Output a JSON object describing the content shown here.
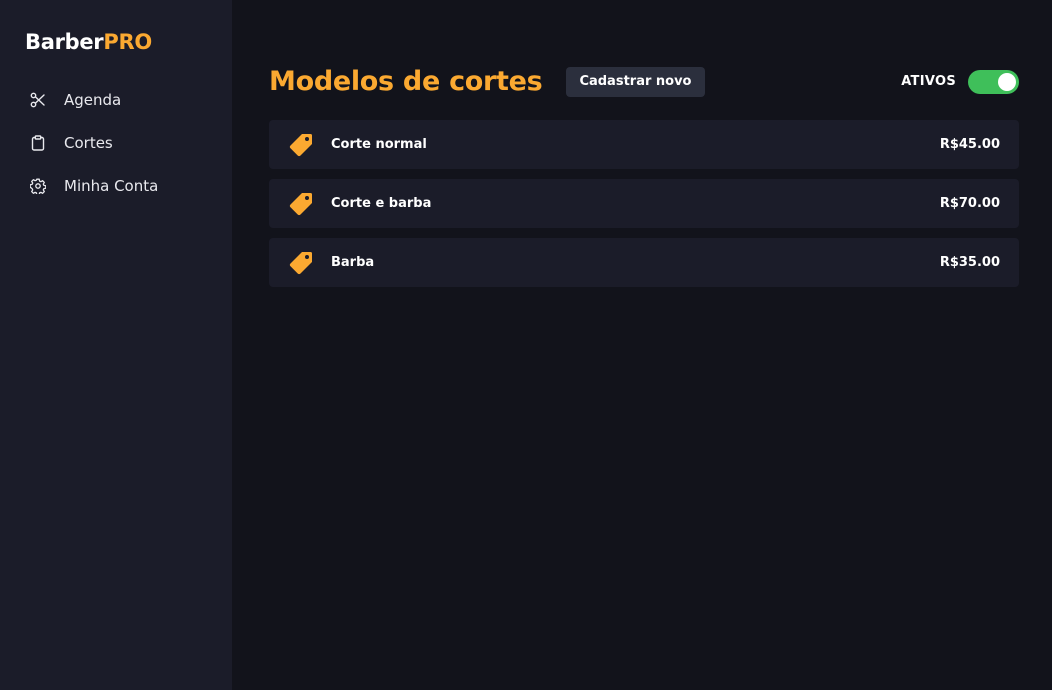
{
  "brand": {
    "part1": "Barber",
    "part2": "PRO",
    "accent": "#fba931"
  },
  "sidebar": {
    "items": [
      {
        "label": "Agenda",
        "icon": "scissors-icon"
      },
      {
        "label": "Cortes",
        "icon": "clipboard-icon"
      },
      {
        "label": "Minha Conta",
        "icon": "gear-icon"
      }
    ]
  },
  "main": {
    "title": "Modelos de cortes",
    "new_button": "Cadastrar novo",
    "status_label": "ATIVOS",
    "toggle_on": true,
    "toggle_color": "#3fbf5a",
    "haircuts": [
      {
        "name": "Corte normal",
        "price": "R$45.00",
        "icon": "price-tag-icon"
      },
      {
        "name": "Corte e barba",
        "price": "R$70.00",
        "icon": "price-tag-icon"
      },
      {
        "name": "Barba",
        "price": "R$35.00",
        "icon": "price-tag-icon"
      }
    ]
  }
}
